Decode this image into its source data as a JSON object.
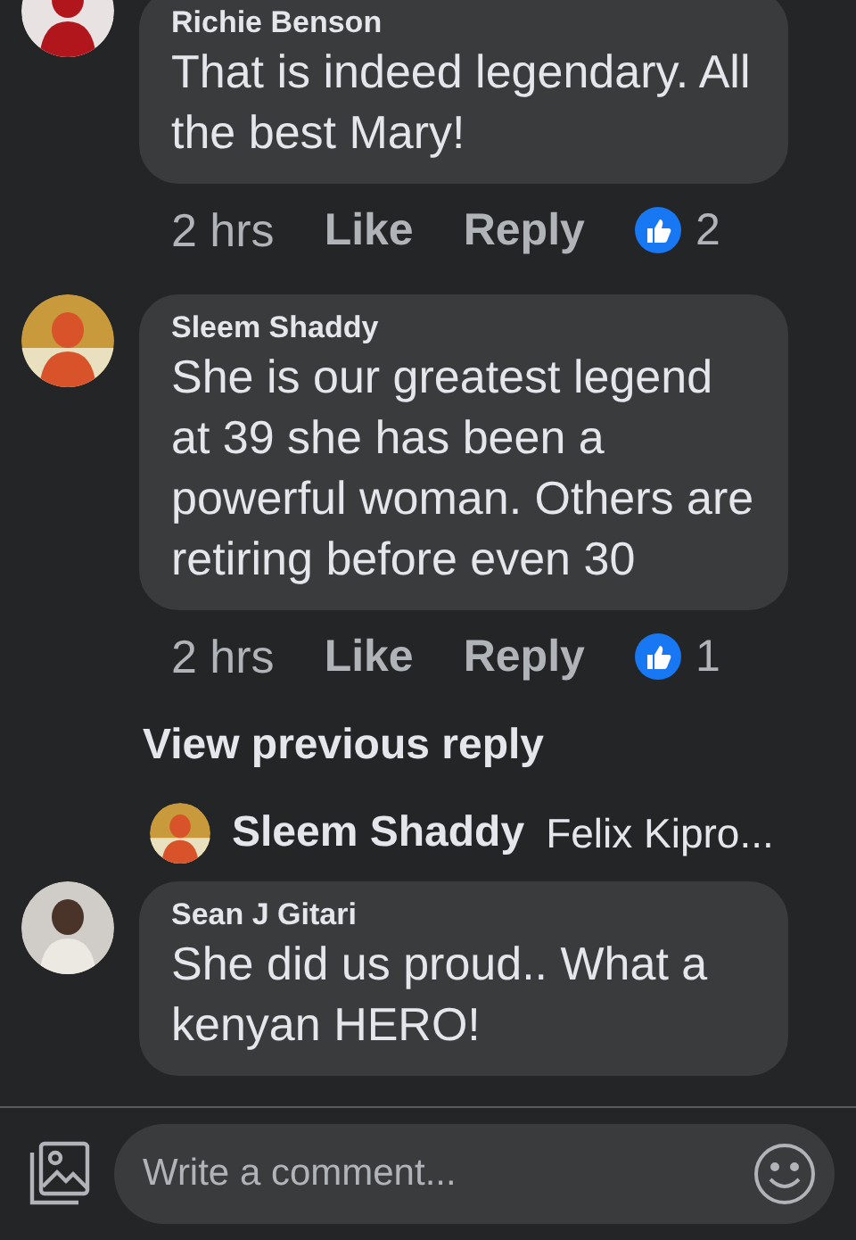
{
  "items": [
    {
      "kind": "comment",
      "author": "Richie Benson",
      "text": "That is indeed legendary. All the best Mary!",
      "time": "2 hrs",
      "like": "Like",
      "reply": "Reply",
      "reactions": "2"
    },
    {
      "kind": "comment",
      "author": "Sleem Shaddy",
      "text": "She is our greatest legend at 39 she has been a powerful woman. Others are retiring before even 30",
      "time": "2 hrs",
      "like": "Like",
      "reply": "Reply",
      "reactions": "1"
    },
    {
      "kind": "link",
      "text": "View previous reply"
    },
    {
      "kind": "reply_preview",
      "author": "Sleem Shaddy",
      "text": "Felix Kipro..."
    },
    {
      "kind": "comment",
      "author": "Sean J Gitari",
      "text": "She did us proud.. What a kenyan HERO!"
    }
  ],
  "composer": {
    "placeholder": "Write a comment..."
  }
}
